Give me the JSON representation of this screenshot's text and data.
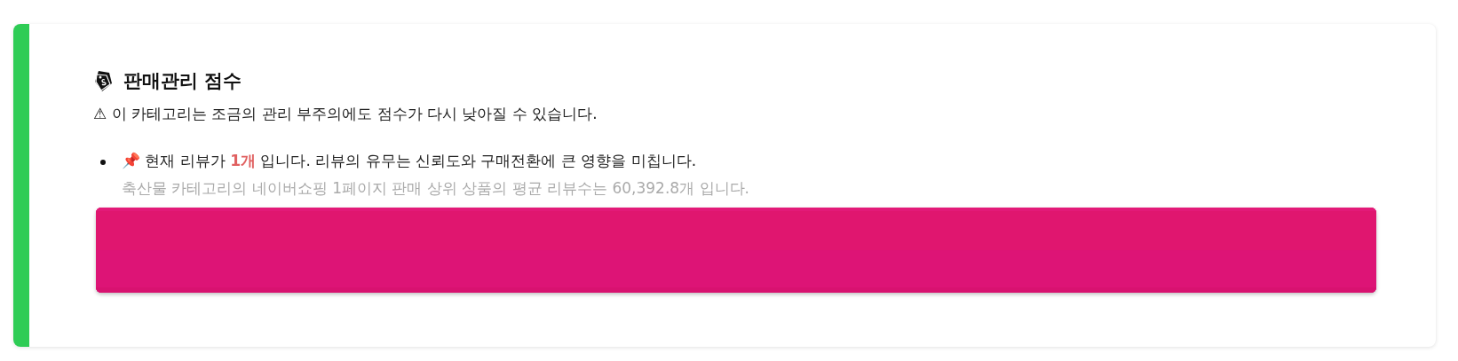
{
  "card": {
    "title": "판매관리 점수",
    "warning": "⚠ 이 카테고리는 조금의 관리 부주의에도 점수가 다시 낮아질 수 있습니다.",
    "items": [
      {
        "text": "📌 현재 리뷰가 **1개** 입니다. 리뷰의 유무는 신뢰도와 구매전환에 큰 영향을 미칩니다.",
        "note": "축산물 카테고리의 네이버쇼핑 1페이지 판매 상위 상품의 평균 리뷰수는 60,392.8개 입니다."
      }
    ]
  }
}
